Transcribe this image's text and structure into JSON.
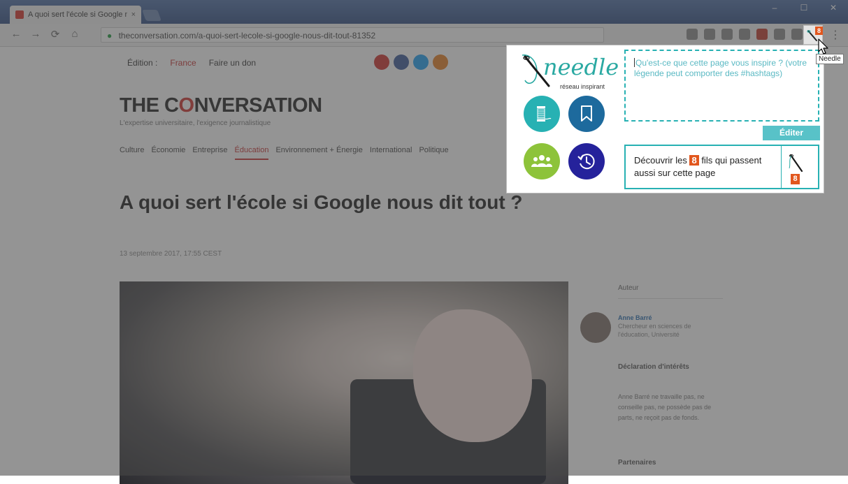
{
  "browser": {
    "tab_title": "A quoi sert l'école si Google nous dit tout ?",
    "tab_close": "×",
    "window_controls": [
      "–",
      "☐",
      "✕"
    ],
    "nav": {
      "back": "←",
      "forward": "→",
      "reload": "⟳",
      "home": "⌂"
    },
    "address": "theconversation.com/a-quoi-sert-lecole-si-google-nous-dit-tout-81352",
    "extension_badge": "8",
    "menu": "⋮"
  },
  "page": {
    "site_nav": [
      "Édition :",
      "France",
      "Faire un don"
    ],
    "logo_pre": "THE C",
    "logo_o": "O",
    "logo_post": "NVERSATION",
    "logo_sub": "L'expertise universitaire, l'exigence journalistique",
    "categories": [
      "Culture",
      "Économie",
      "Entreprise",
      "Éducation",
      "Environnement + Énergie",
      "International",
      "Politique"
    ],
    "headline": "A quoi sert l'école si Google nous dit tout ?",
    "date": "13 septembre 2017, 17:55 CEST",
    "aside": {
      "title": "Auteur",
      "author_name": "Anne Barré",
      "author_role": "Chercheur en sciences de l'éducation, Université",
      "disclosure_title": "Déclaration d'intérêts",
      "disclosure_text": "Anne Barré ne travaille pas, ne conseille pas, ne possède pas de parts, ne reçoit pas de fonds.",
      "partners_title": "Partenaires"
    }
  },
  "popup": {
    "brand_word": "needle",
    "brand_sub": "réseau inspirant",
    "caption_placeholder": "Qu'est-ce que cette page vous inspire ? (votre légende peut comporter des #hashtags)",
    "edit_label": "Éditer",
    "discover_pre": "Découvrir les ",
    "discover_count": "8",
    "discover_post": " fils qui passent aussi sur cette page",
    "discover_badge": "8",
    "colors": {
      "teal": "#27b1b3",
      "blue": "#1d6a9d",
      "green": "#8dc33a",
      "indigo": "#25229b",
      "orange": "#e2571e"
    }
  },
  "tooltip": "Needle"
}
